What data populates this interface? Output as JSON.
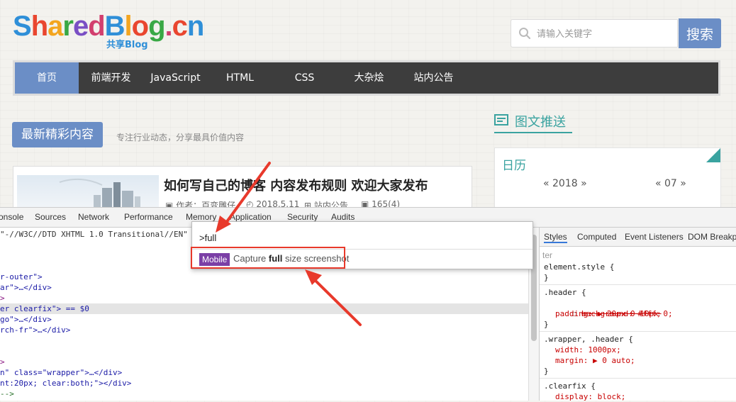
{
  "site": {
    "logo_text": "SharedBlog.cn",
    "logo_sub": "共享Blog",
    "search_placeholder": "请输入关键字",
    "search_button": "搜索",
    "nav": [
      "首页",
      "前端开发",
      "JavaScript",
      "HTML",
      "CSS",
      "大杂烩",
      "站内公告"
    ],
    "section_title": "最新精彩内容",
    "section_sub": "专注行业动态，分享最具价值内容",
    "article": {
      "title": "如何写自己的博客 内容发布规则 欢迎大家发布",
      "author": "作者：百变雕仔",
      "date": "2018.5.11",
      "category": "站内公告",
      "views": "165(4)"
    },
    "sidebar_title": "图文推送",
    "calendar": {
      "title": "日历",
      "year": "« 2018 »",
      "month": "« 07 »"
    }
  },
  "devtools": {
    "tabs": [
      "onsole",
      "Sources",
      "Network",
      "Performance",
      "Memory",
      "Application",
      "Security",
      "Audits"
    ],
    "code_lines": [
      {
        "pre": "\"-//W3C//DTD XHTML 1.0 Transitional//EN\"",
        "kind": "doctype"
      },
      {
        "pre": ">",
        "kind": "t"
      },
      {
        "pre": "",
        "kind": "t"
      },
      {
        "pre": "r-outer\">",
        "kind": "v"
      },
      {
        "pre": "ar\">…</div>",
        "kind": "v"
      },
      {
        "pre": ">",
        "kind": "t"
      },
      {
        "pre": "er clearfix\"> == $0",
        "kind": "hl"
      },
      {
        "pre": "go\">…</div>",
        "kind": "v"
      },
      {
        "pre": "rch-fr\">…</div>",
        "kind": "v"
      },
      {
        "pre": "",
        "kind": "t"
      },
      {
        "pre": "",
        "kind": "t"
      },
      {
        "pre": ">",
        "kind": "t"
      },
      {
        "pre": "n\" class=\"wrapper\">…</div>",
        "kind": "v"
      },
      {
        "pre": "nt:20px; clear:both;\"></div>",
        "kind": "v"
      },
      {
        "pre": "-->",
        "kind": "c"
      }
    ],
    "styles_tabs": [
      "Styles",
      "Computed",
      "Event Listeners",
      "DOM Breakpoints"
    ],
    "filter_placeholder": "ter",
    "rules": [
      "element.style {",
      "}",
      ".header {",
      "background: #fff;",
      "padding: ▶ 20px 0 10px 0;",
      "}",
      ".wrapper, .header {",
      "width: 1000px;",
      "margin: ▶ 0 auto;",
      "}",
      ".clearfix {",
      "display: block;"
    ],
    "command": {
      "query": ">full",
      "badge": "Mobile",
      "text_before": "Capture ",
      "text_bold": "full",
      "text_after": " size screenshot"
    }
  },
  "colors": {
    "accent": "#6b8ec6",
    "teal": "#3aa3a0",
    "annotation": "#e8392b",
    "badge": "#7b3fa6"
  }
}
